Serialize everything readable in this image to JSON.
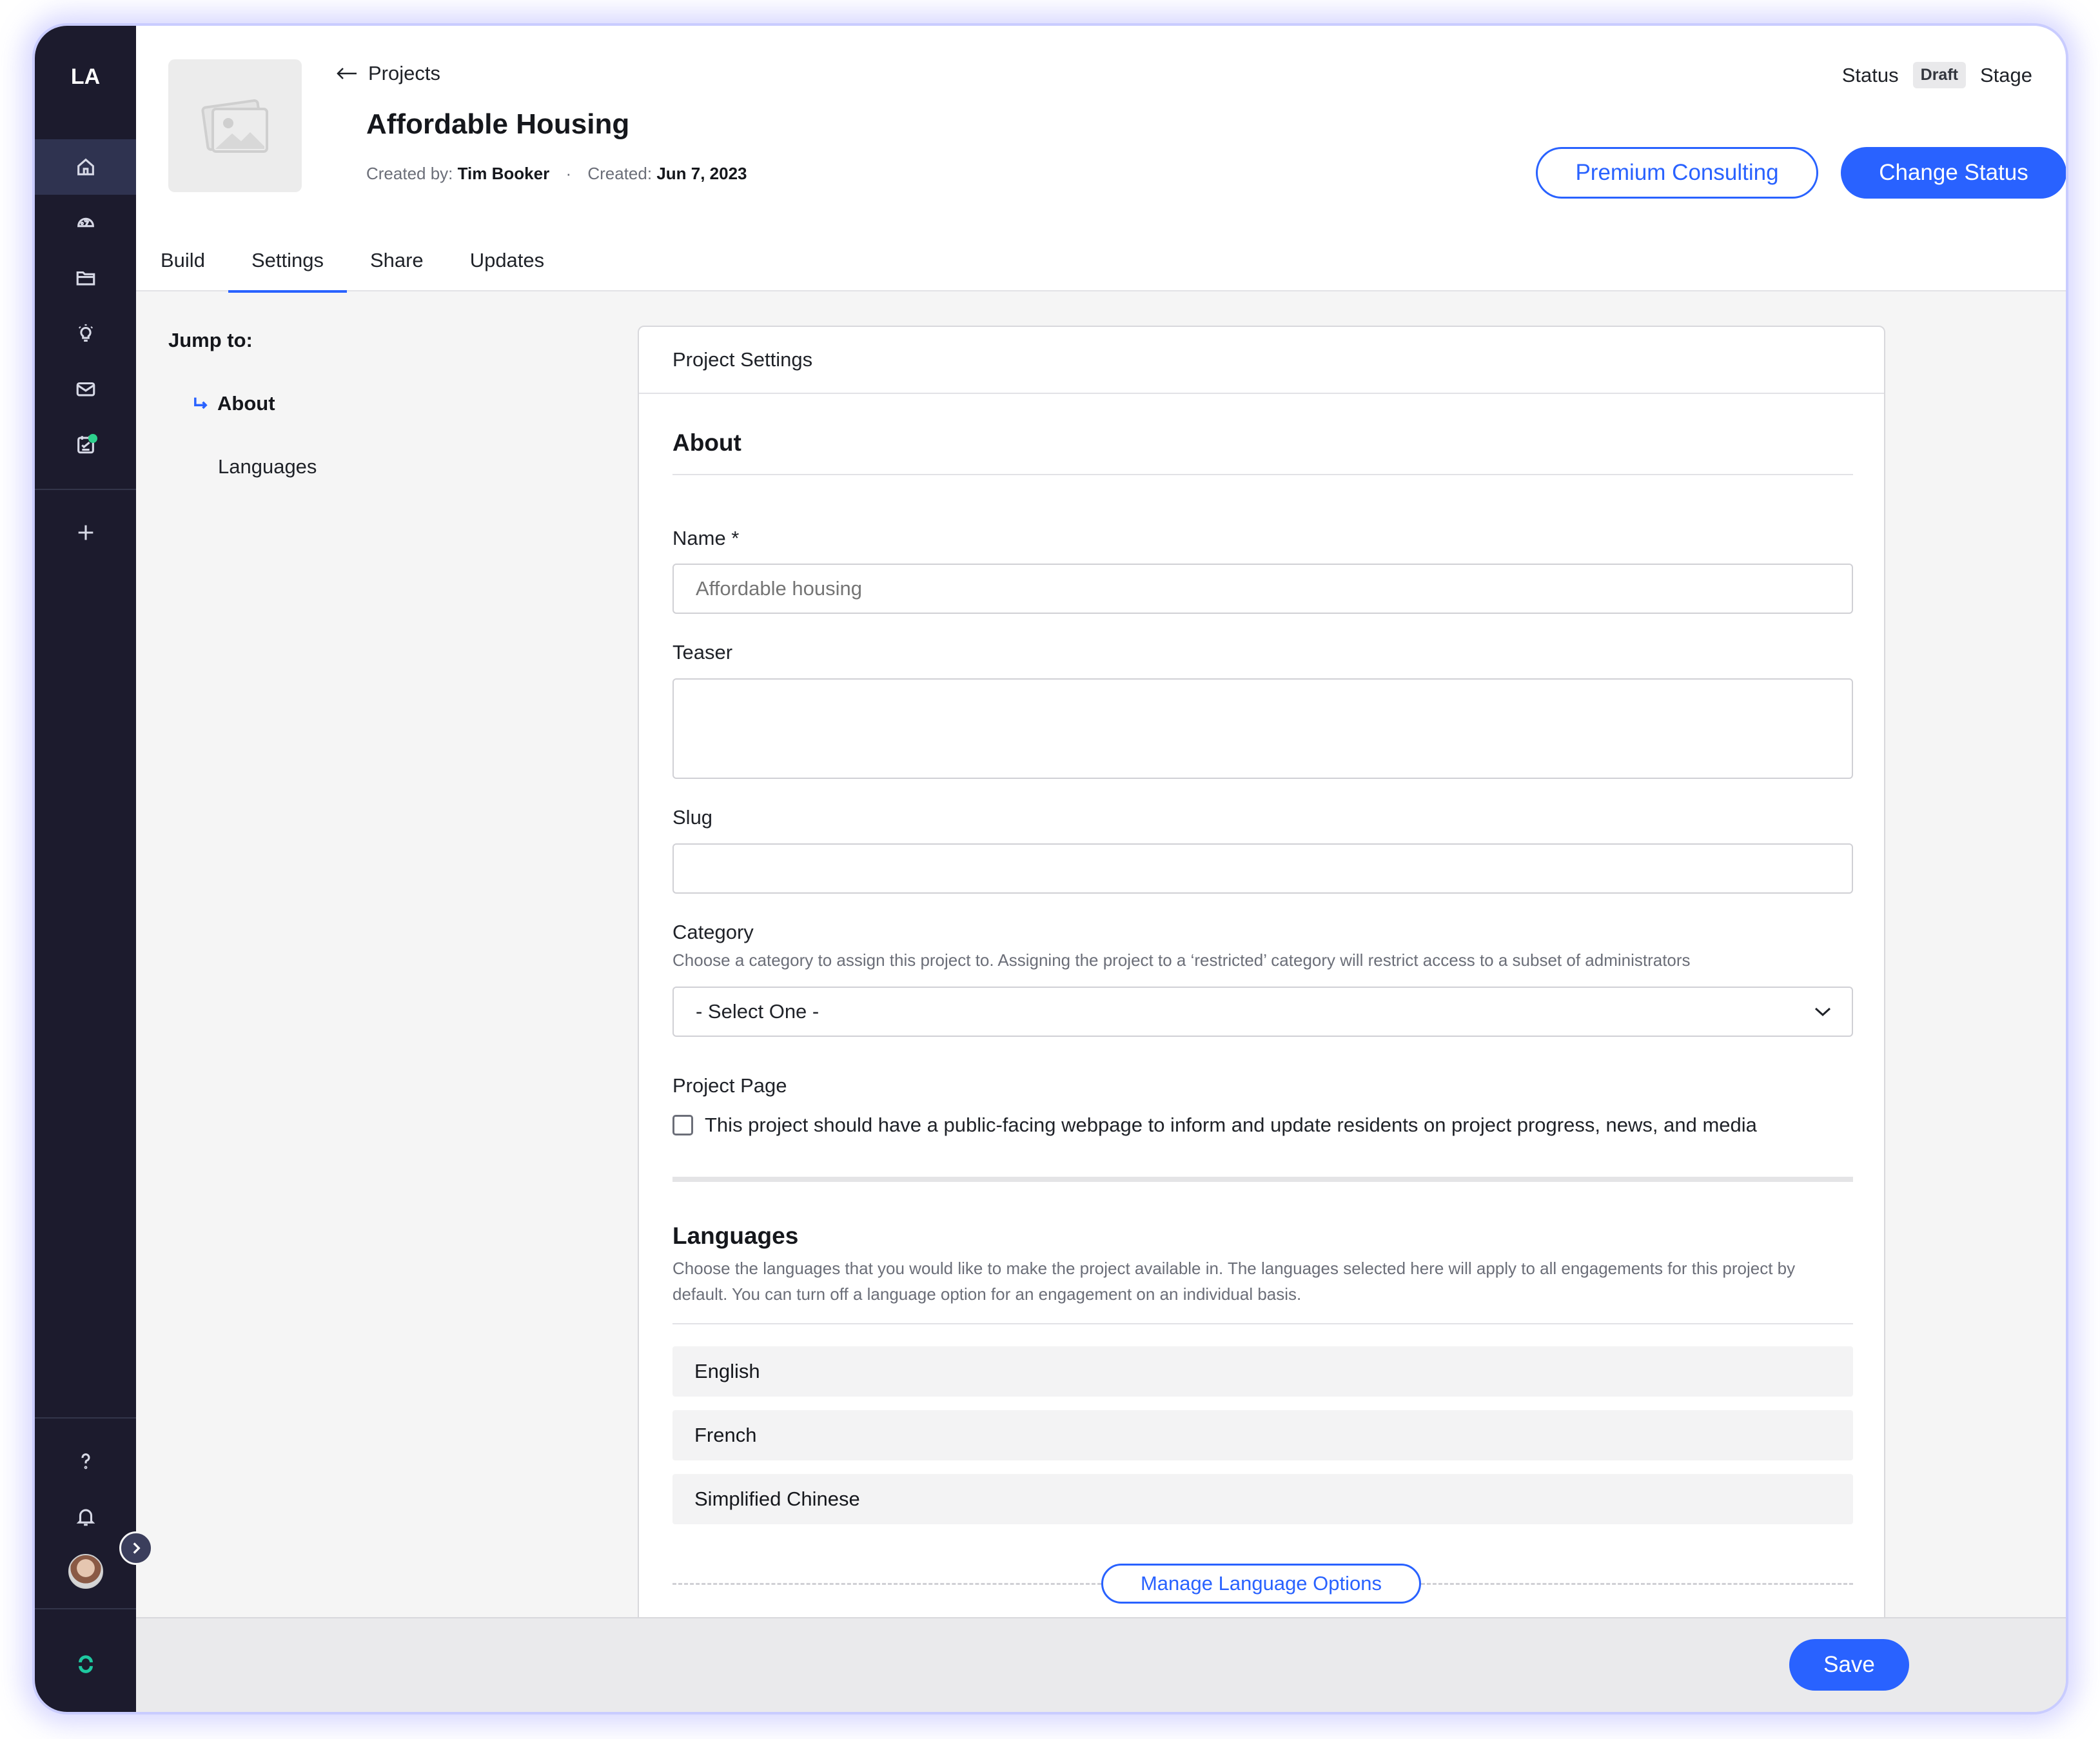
{
  "app": {
    "logo": "LA"
  },
  "header": {
    "back_label": "Projects",
    "title": "Affordable Housing",
    "created_by_label": "Created by:",
    "created_by": "Tim Booker",
    "created_label": "Created:",
    "created_date": "Jun 7, 2023",
    "status_label": "Status",
    "status_value": "Draft",
    "stage_label": "Stage",
    "premium_button": "Premium Consulting",
    "change_status_button": "Change Status"
  },
  "tabs": [
    {
      "label": "Build",
      "active": false
    },
    {
      "label": "Settings",
      "active": true
    },
    {
      "label": "Share",
      "active": false
    },
    {
      "label": "Updates",
      "active": false
    }
  ],
  "jump": {
    "title": "Jump to:",
    "items": [
      {
        "label": "About",
        "active": true
      },
      {
        "label": "Languages",
        "active": false
      }
    ]
  },
  "settings": {
    "card_title": "Project Settings",
    "about": {
      "title": "About",
      "name_label": "Name *",
      "name_placeholder": "Affordable housing",
      "teaser_label": "Teaser",
      "slug_label": "Slug",
      "category_label": "Category",
      "category_help": "Choose a category to assign this project to. Assigning the project to a ‘restricted’ category will restrict access to a subset of administrators",
      "category_value": "- Select One -",
      "project_page_label": "Project Page",
      "project_page_checkbox": "This project should have a public-facing webpage to inform and update residents on project progress, news, and media",
      "project_page_checked": false
    },
    "languages": {
      "title": "Languages",
      "help": "Choose the languages that you would like to make the project available in. The languages selected here will apply to all engagements for this project by default. You can turn off a language option for an engagement on an individual basis.",
      "items": [
        "English",
        "French",
        "Simplified Chinese"
      ],
      "manage_button": "Manage Language Options"
    }
  },
  "footer": {
    "save_button": "Save"
  },
  "colors": {
    "accent": "#2962ff",
    "rail": "#1c1b2d",
    "notification_dot": "#2ed18d"
  },
  "rail_icons": [
    "home-icon",
    "dashboard-icon",
    "folder-icon",
    "lightbulb-icon",
    "mail-icon",
    "checklist-icon",
    "plus-icon",
    "help-icon",
    "bell-icon",
    "avatar",
    "brand-icon"
  ]
}
